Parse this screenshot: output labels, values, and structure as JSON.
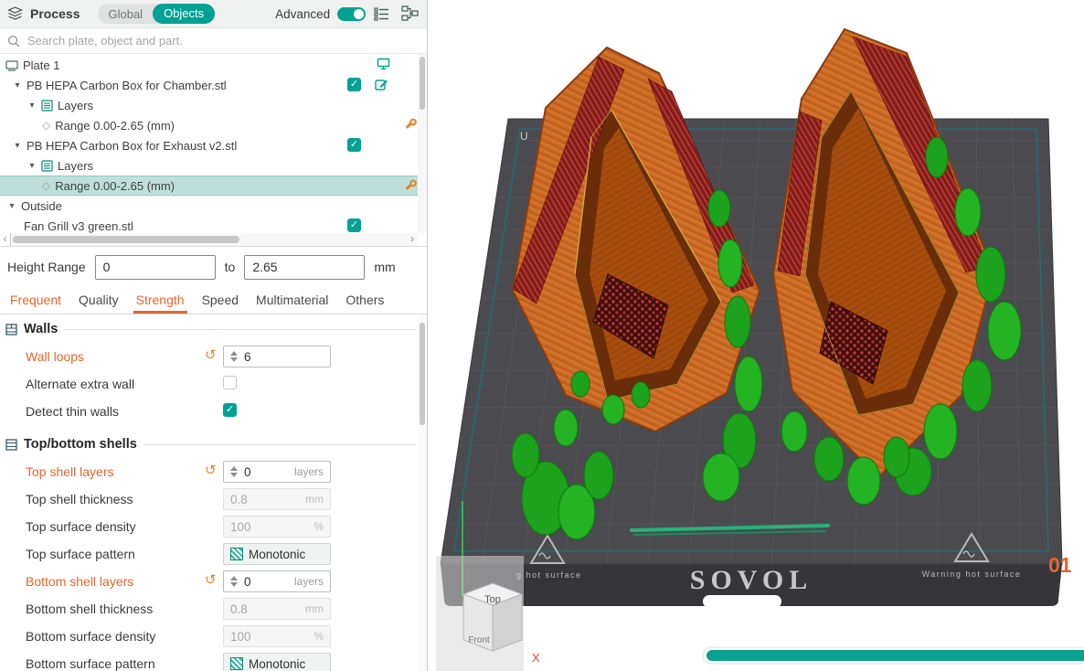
{
  "colors": {
    "accent_teal": "#00a294",
    "modified_orange": "#e2662e",
    "selected_row": "#bfe0da",
    "model_orange": "#c9661f",
    "support_green": "#1ca21c",
    "plate_gray": "#4b4b4f"
  },
  "header": {
    "title": "Process",
    "segment_global": "Global",
    "segment_objects": "Objects",
    "advanced_label": "Advanced"
  },
  "search": {
    "placeholder": "Search plate, object and part."
  },
  "tree": {
    "items": [
      {
        "label": "Plate 1"
      },
      {
        "label": "PB HEPA Carbon Box for Chamber.stl"
      },
      {
        "label": "Layers"
      },
      {
        "label": "Range 0.00-2.65 (mm)"
      },
      {
        "label": "PB HEPA Carbon Box for Exhaust v2.stl"
      },
      {
        "label": "Layers"
      },
      {
        "label": "Range 0.00-2.65 (mm)"
      },
      {
        "label": "Outside"
      },
      {
        "label": "Fan Grill v3 green.stl"
      }
    ],
    "hscroll_left": "‹",
    "hscroll_right": "›"
  },
  "height_range": {
    "label": "Height Range",
    "from_value": "0",
    "to_word": "to",
    "to_value": "2.65",
    "unit": "mm"
  },
  "tabs": {
    "frequent": "Frequent",
    "quality": "Quality",
    "strength": "Strength",
    "speed": "Speed",
    "multimaterial": "Multimaterial",
    "others": "Others"
  },
  "settings": {
    "walls": {
      "title": "Walls",
      "rows": [
        {
          "label": "Wall loops",
          "value": "6"
        },
        {
          "label": "Alternate extra wall"
        },
        {
          "label": "Detect thin walls"
        }
      ]
    },
    "shells": {
      "title": "Top/bottom shells",
      "rows": [
        {
          "label": "Top shell layers",
          "value": "0",
          "unit": "layers"
        },
        {
          "label": "Top shell thickness",
          "value": "0.8",
          "unit": "mm"
        },
        {
          "label": "Top surface density",
          "value": "100",
          "unit": "%"
        },
        {
          "label": "Top surface pattern",
          "value": "Monotonic"
        },
        {
          "label": "Bottom shell layers",
          "value": "0",
          "unit": "layers"
        },
        {
          "label": "Bottom shell thickness",
          "value": "0.8",
          "unit": "mm"
        },
        {
          "label": "Bottom surface density",
          "value": "100",
          "unit": "%"
        },
        {
          "label": "Bottom surface pattern",
          "value": "Monotonic"
        }
      ]
    }
  },
  "viewport": {
    "brand": "SOVOL",
    "warning_right": "Warning hot surface",
    "warning_left": "g hot surface",
    "plate_marking": "U",
    "object_number": "01",
    "gizmo": {
      "top": "Top",
      "front": "Front",
      "x": "X"
    }
  }
}
